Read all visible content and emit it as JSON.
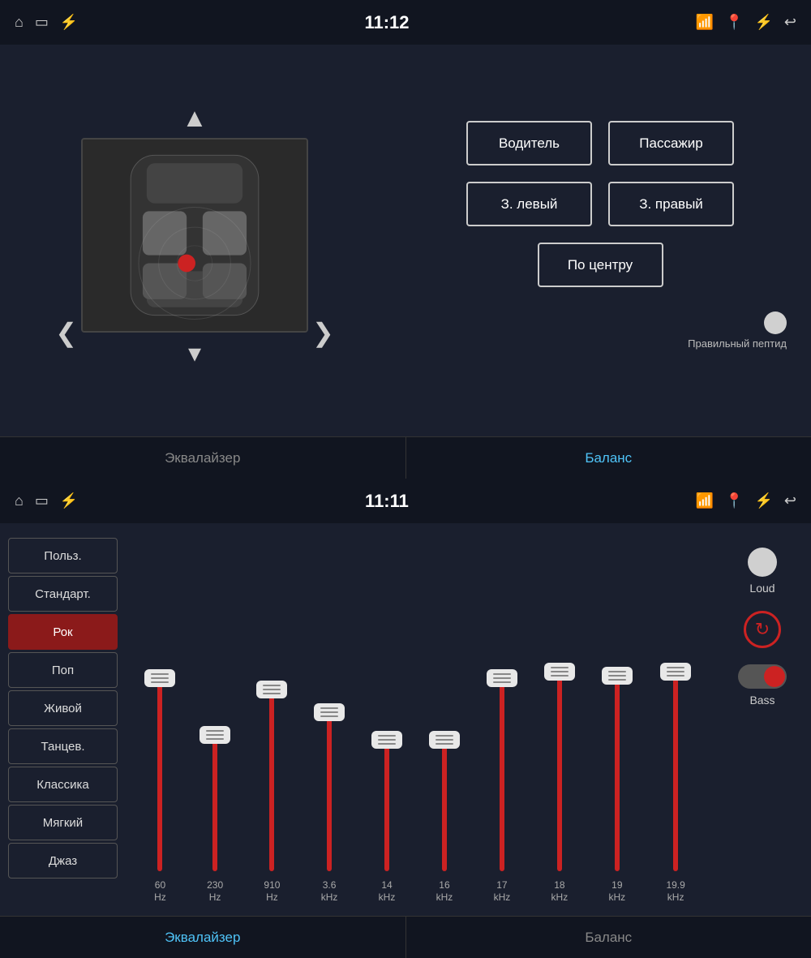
{
  "top": {
    "statusBar": {
      "time": "11:12",
      "icons_left": [
        "home-icon",
        "screen-icon",
        "usb-icon"
      ],
      "icons_right": [
        "cast-icon",
        "location-icon",
        "bluetooth-icon",
        "back-icon"
      ]
    },
    "navButtons": {
      "up": "▲",
      "down": "▼",
      "left": "❮",
      "right": "❯"
    },
    "seatButtons": [
      {
        "label": "Водитель",
        "id": "driver"
      },
      {
        "label": "Пассажир",
        "id": "passenger"
      },
      {
        "label": "З. левый",
        "id": "rear-left"
      },
      {
        "label": "З. правый",
        "id": "rear-right"
      },
      {
        "label": "По центру",
        "id": "center"
      }
    ],
    "toggleLabel": "Правильный пептид",
    "tabs": [
      {
        "label": "Эквалайзер",
        "active": false
      },
      {
        "label": "Баланс",
        "active": true
      }
    ]
  },
  "bottom": {
    "statusBar": {
      "time": "11:11",
      "icons_left": [
        "home-icon",
        "screen-icon",
        "usb-icon"
      ],
      "icons_right": [
        "cast-icon",
        "location-icon",
        "bluetooth-icon",
        "back-icon"
      ]
    },
    "presets": [
      {
        "label": "Польз.",
        "active": false
      },
      {
        "label": "Стандарт.",
        "active": false
      },
      {
        "label": "Рок",
        "active": true
      },
      {
        "label": "Поп",
        "active": false
      },
      {
        "label": "Живой",
        "active": false
      },
      {
        "label": "Танцев.",
        "active": false
      },
      {
        "label": "Классика",
        "active": false
      },
      {
        "label": "Мягкий",
        "active": false
      },
      {
        "label": "Джаз",
        "active": false
      }
    ],
    "sliders": [
      {
        "freq": "60",
        "unit": "Hz",
        "heightPct": 85,
        "handleTop": 15
      },
      {
        "freq": "230",
        "unit": "Hz",
        "heightPct": 60,
        "handleTop": 40
      },
      {
        "freq": "910",
        "unit": "Hz",
        "heightPct": 80,
        "handleTop": 20
      },
      {
        "freq": "3.6",
        "unit": "kHz",
        "heightPct": 70,
        "handleTop": 30
      },
      {
        "freq": "14",
        "unit": "kHz",
        "heightPct": 58,
        "handleTop": 42
      },
      {
        "freq": "16",
        "unit": "kHz",
        "heightPct": 58,
        "handleTop": 42
      },
      {
        "freq": "17",
        "unit": "kHz",
        "heightPct": 85,
        "handleTop": 15
      },
      {
        "freq": "18",
        "unit": "kHz",
        "heightPct": 88,
        "handleTop": 12
      },
      {
        "freq": "19",
        "unit": "kHz",
        "heightPct": 86,
        "handleTop": 14
      },
      {
        "freq": "19.9",
        "unit": "kHz",
        "heightPct": 88,
        "handleTop": 12
      }
    ],
    "controls": {
      "loud": "Loud",
      "bass": "Bass",
      "reset": "↻"
    },
    "tabs": [
      {
        "label": "Эквалайзер",
        "active": true
      },
      {
        "label": "Баланс",
        "active": false
      }
    ]
  }
}
